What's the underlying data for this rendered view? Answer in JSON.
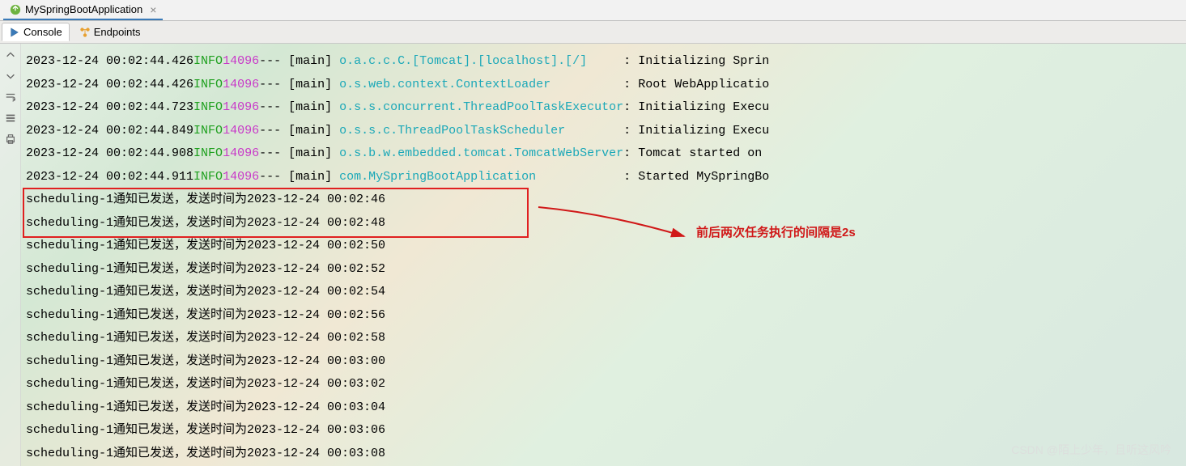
{
  "tab": {
    "title": "MySpringBootApplication",
    "close": "×"
  },
  "toolbar": {
    "tabs": [
      {
        "label": "Console",
        "icon": "run-arrow"
      },
      {
        "label": "Endpoints",
        "icon": "endpoints"
      }
    ]
  },
  "log": {
    "info_lines": [
      {
        "ts": "2023-12-24 00:02:44.426",
        "level": "INFO",
        "pid": "14096",
        "dashes": "---",
        "thread": "main",
        "logger": "o.a.c.c.C.[Tomcat].[localhost].[/]     ",
        "msg": "Initializing Sprin"
      },
      {
        "ts": "2023-12-24 00:02:44.426",
        "level": "INFO",
        "pid": "14096",
        "dashes": "---",
        "thread": "main",
        "logger": "o.s.web.context.ContextLoader          ",
        "msg": "Root WebApplicatio"
      },
      {
        "ts": "2023-12-24 00:02:44.723",
        "level": "INFO",
        "pid": "14096",
        "dashes": "---",
        "thread": "main",
        "logger": "o.s.s.concurrent.ThreadPoolTaskExecutor",
        "msg": "Initializing Execu"
      },
      {
        "ts": "2023-12-24 00:02:44.849",
        "level": "INFO",
        "pid": "14096",
        "dashes": "---",
        "thread": "main",
        "logger": "o.s.s.c.ThreadPoolTaskScheduler        ",
        "msg": "Initializing Execu"
      },
      {
        "ts": "2023-12-24 00:02:44.908",
        "level": "INFO",
        "pid": "14096",
        "dashes": "---",
        "thread": "main",
        "logger": "o.s.b.w.embedded.tomcat.TomcatWebServer",
        "msg": "Tomcat started on "
      },
      {
        "ts": "2023-12-24 00:02:44.911",
        "level": "INFO",
        "pid": "14096",
        "dashes": "---",
        "thread": "main",
        "logger": "com.MySpringBootApplication            ",
        "msg": "Started MySpringBo"
      }
    ],
    "sched_prefix": "scheduling-1通知已发送，发送时间为",
    "sched_times": [
      "2023-12-24 00:02:46",
      "2023-12-24 00:02:48",
      "2023-12-24 00:02:50",
      "2023-12-24 00:02:52",
      "2023-12-24 00:02:54",
      "2023-12-24 00:02:56",
      "2023-12-24 00:02:58",
      "2023-12-24 00:03:00",
      "2023-12-24 00:03:02",
      "2023-12-24 00:03:04",
      "2023-12-24 00:03:06",
      "2023-12-24 00:03:08"
    ]
  },
  "annotation": "前后两次任务执行的间隔是2s",
  "watermark": "CSDN @陌上少年，且听这风吟"
}
